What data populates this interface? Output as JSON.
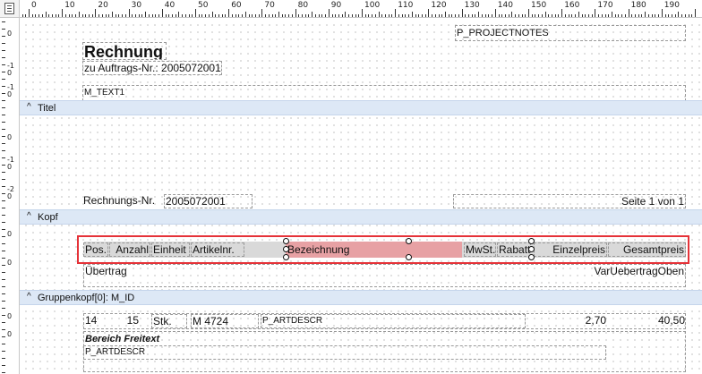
{
  "ruler": {
    "top_labels": [
      "0",
      "10",
      "20",
      "30",
      "40",
      "50",
      "60",
      "70",
      "80",
      "90",
      "100",
      "110",
      "120",
      "130",
      "140",
      "150",
      "160",
      "170",
      "180",
      "190"
    ],
    "left_labels": [
      "0",
      "-1\n0",
      "-1\n0",
      "0",
      "-1\n0",
      "-2\n0",
      "0",
      "0",
      "0",
      "0"
    ]
  },
  "report": {
    "projectnotes": "P_PROJECTNOTES",
    "title": "Rechnung",
    "order_line": "zu Auftrags-Nr.: 2005072001",
    "mtext": "M_TEXT1"
  },
  "bands": {
    "titel": "Titel",
    "kopf": "Kopf",
    "gruppenkopf": "Gruppenkopf[0]: M_ID"
  },
  "titel_band": {
    "invoice_label": "Rechnungs-Nr.",
    "invoice_value": "2005072001",
    "page": "Seite 1 von 1"
  },
  "kopf_band": {
    "columns": [
      "Pos.",
      "Anzahl",
      "Einheit",
      "Artikelnr.",
      "Bezeichnung",
      "MwSt.",
      "Rabatt",
      "Einzelpreis",
      "Gesamtpreis"
    ],
    "uebertrag": "Übertrag",
    "uebertrag_value": "VarUebertragOben"
  },
  "group_band": {
    "row": [
      "14",
      "15",
      "Stk.",
      "M 4724",
      "P_ARTDESCR",
      "",
      "",
      "2,70",
      "40,50"
    ],
    "freetext_label": "Bereich Freitext",
    "artdescr": "P_ARTDESCR"
  }
}
